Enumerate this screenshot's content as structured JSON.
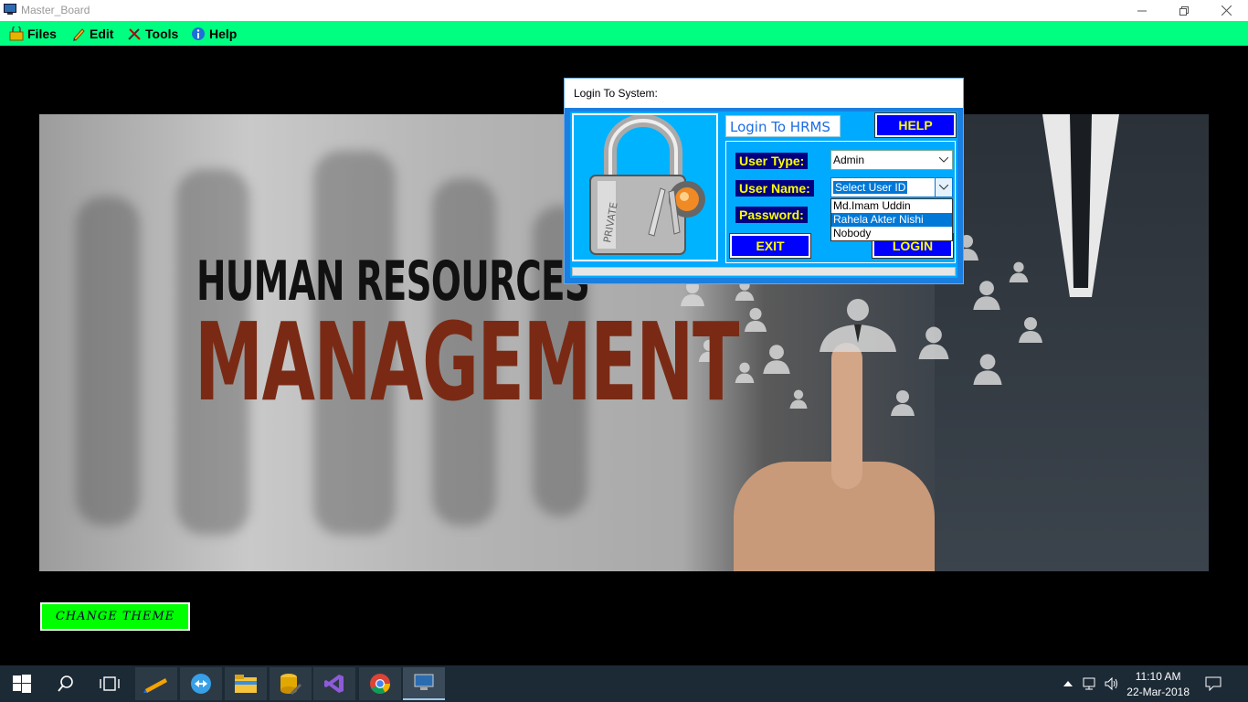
{
  "window": {
    "title": "Master_Board",
    "minimize": "—",
    "restore": "❐",
    "close": "✕"
  },
  "menu": {
    "items": [
      {
        "label": "Files",
        "icon": "folder-lock-icon"
      },
      {
        "label": "Edit",
        "icon": "pencil-icon"
      },
      {
        "label": "Tools",
        "icon": "tools-icon"
      },
      {
        "label": "Help",
        "icon": "info-icon"
      }
    ]
  },
  "banner": {
    "line1": "HUMAN RESOURCES",
    "line2": "MANAGEMENT"
  },
  "change_theme_label": "CHANGE THEME",
  "login": {
    "dialog_title": "Login To System:",
    "header_label": "Login To HRMS",
    "help_label": "HELP",
    "lock_caption": "PRIVATE",
    "user_type_label": "User Type:",
    "user_type_value": "Admin",
    "user_name_label": "User Name:",
    "user_name_value": "Select User ID",
    "password_label": "Password:",
    "user_options": [
      "Md.Imam Uddin",
      "Rahela Akter Nishi",
      "Nobody"
    ],
    "highlighted_option": "Rahela Akter Nishi",
    "exit_label": "EXIT",
    "login_label": "LOGIN",
    "colors": {
      "button_bg": "#0000ff",
      "button_text": "#ffff00",
      "label_bg": "#000080"
    }
  },
  "taskbar": {
    "apps": [
      "start-icon",
      "search-icon",
      "task-view-icon",
      "app-pencil-icon",
      "teamviewer-icon",
      "file-explorer-icon",
      "database-tools-icon",
      "visual-studio-icon",
      "chrome-icon",
      "master-board-icon"
    ],
    "time": "11:10 AM",
    "date": "22-Mar-2018"
  },
  "colors": {
    "menubar": "#00ff80",
    "accent": "#00aaff",
    "change_theme": "#00ff00"
  }
}
